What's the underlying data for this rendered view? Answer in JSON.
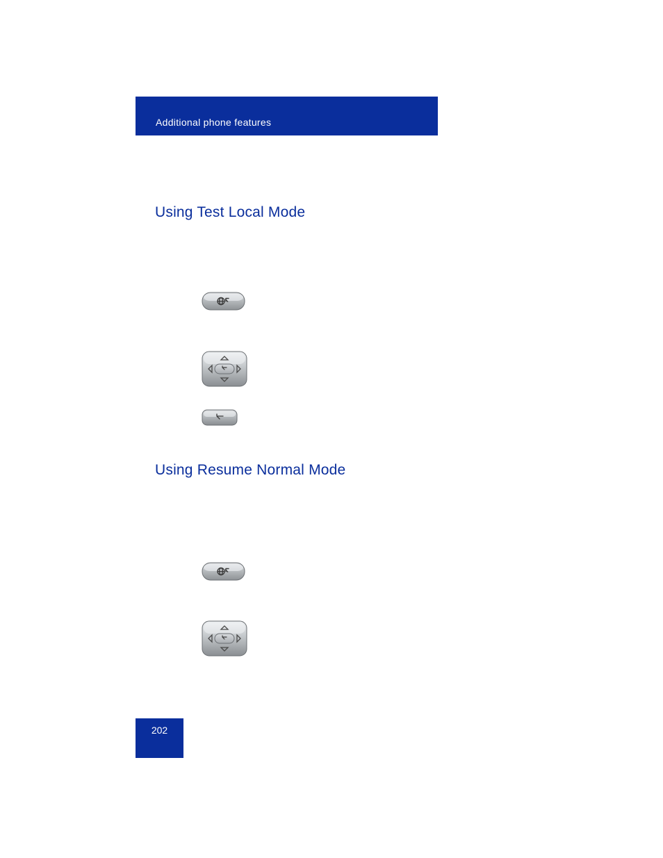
{
  "header": {
    "title": "Additional phone features"
  },
  "sections": {
    "s1": {
      "heading": "Using Test Local Mode"
    },
    "s2": {
      "heading": "Using Resume Normal Mode"
    }
  },
  "buttons": {
    "b1": {
      "name": "services-key-icon"
    },
    "b2": {
      "name": "navigation-key-icon"
    },
    "b3": {
      "name": "enter-key-icon"
    },
    "b4": {
      "name": "services-key-icon"
    },
    "b5": {
      "name": "navigation-key-icon"
    }
  },
  "pageNumber": "202"
}
